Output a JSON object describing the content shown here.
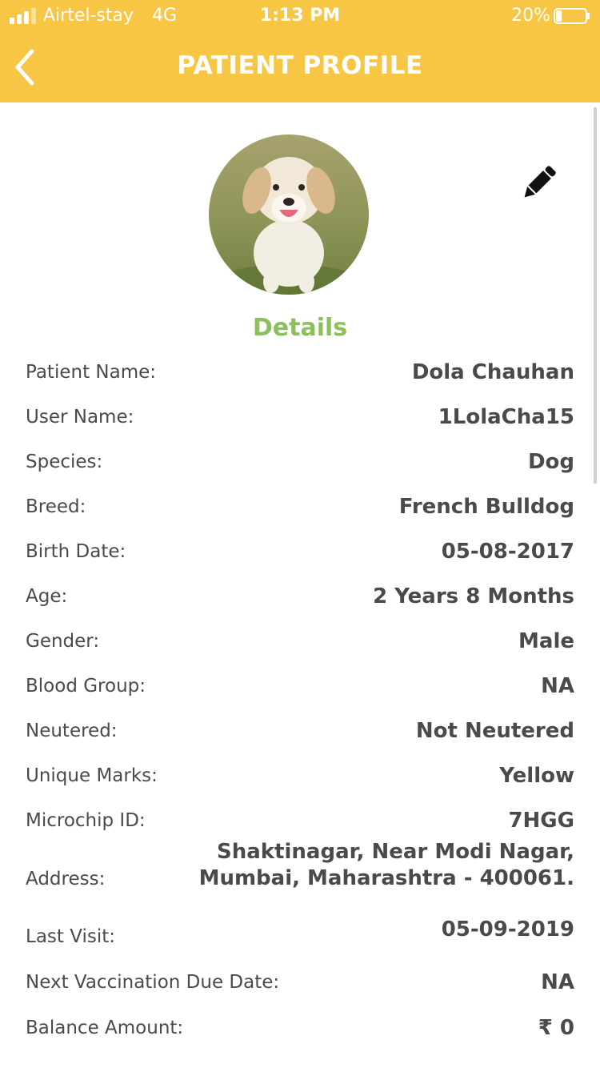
{
  "status_bar": {
    "carrier": "Airtel-stay",
    "network": "4G",
    "time": "1:13 PM",
    "battery": "20%",
    "battery_level": 0.2
  },
  "header": {
    "title": "PATIENT PROFILE",
    "back_icon": "chevron-left-icon",
    "background_color": "#F6C644"
  },
  "profile": {
    "photo_icon": "pet-photo",
    "edit_icon": "pencil-icon"
  },
  "section_title": "Details",
  "accent_color": "#8DC05C",
  "details": [
    {
      "label": "Patient Name:",
      "value": "Dola Chauhan"
    },
    {
      "label": "User Name:",
      "value": "1LolaCha15"
    },
    {
      "label": "Species:",
      "value": "Dog"
    },
    {
      "label": "Breed:",
      "value": "French Bulldog"
    },
    {
      "label": "Birth Date:",
      "value": "05-08-2017"
    },
    {
      "label": "Age:",
      "value": "2 Years 8 Months"
    },
    {
      "label": "Gender:",
      "value": "Male"
    },
    {
      "label": "Blood Group:",
      "value": "NA"
    },
    {
      "label": "Neutered:",
      "value": "Not Neutered"
    },
    {
      "label": "Unique Marks:",
      "value": "Yellow"
    },
    {
      "label": "Microchip ID:",
      "value": "7HGG"
    },
    {
      "label": "Address:",
      "value": "Shaktinagar, Near Modi Nagar,\nMumbai, Maharashtra - 400061."
    },
    {
      "label": "Last Visit:",
      "value": "05-09-2019"
    },
    {
      "label": "Next Vaccination Due Date:",
      "value": "NA"
    },
    {
      "label": "Balance Amount:",
      "value": "₹ 0"
    }
  ]
}
